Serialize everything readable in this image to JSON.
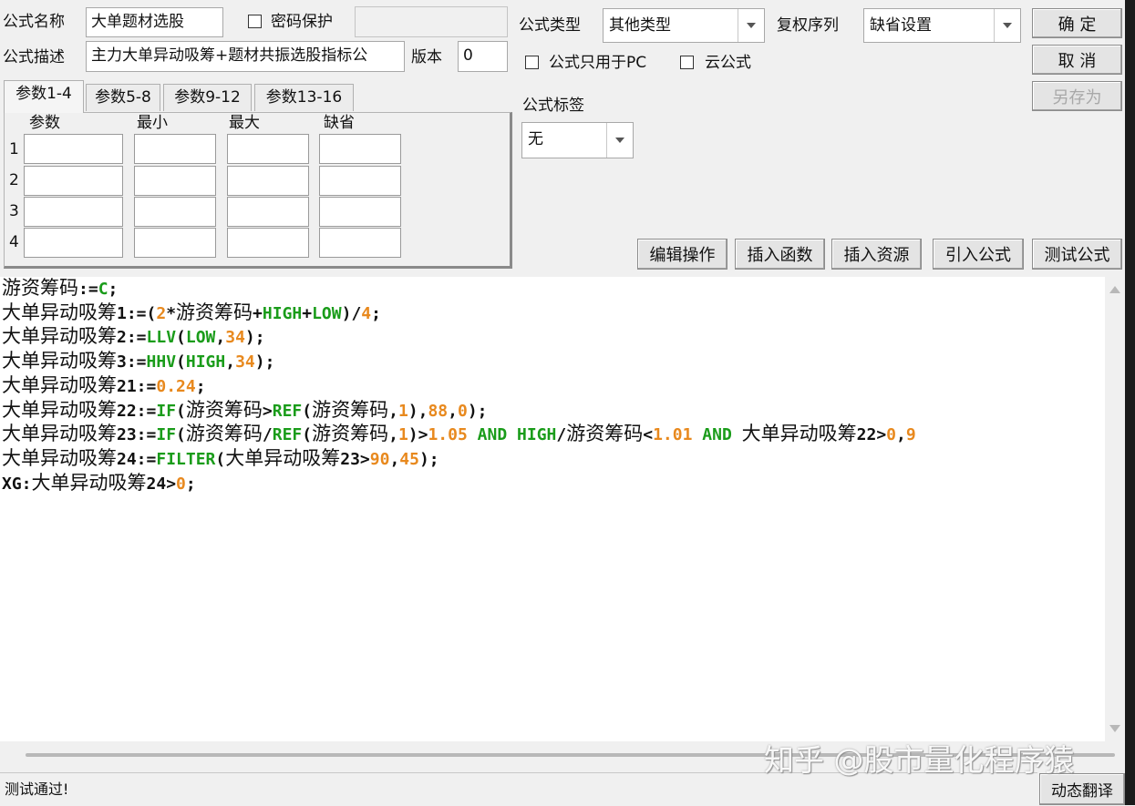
{
  "form": {
    "name_label": "公式名称",
    "name_value": "大单题材选股",
    "password_label": "密码保护",
    "desc_label": "公式描述",
    "desc_value": "主力大单异动吸筹+题材共振选股指标公",
    "version_label": "版本",
    "version_value": "0",
    "type_label": "公式类型",
    "type_value": "其他类型",
    "fq_label": "复权序列",
    "fq_value": "缺省设置",
    "pc_only_label": "公式只用于PC",
    "cloud_label": "云公式",
    "tag_label": "公式标签",
    "tag_value": "无"
  },
  "buttons": {
    "ok": "确 定",
    "cancel": "取 消",
    "save_as": "另存为",
    "edit_ops": "编辑操作",
    "insert_func": "插入函数",
    "insert_res": "插入资源",
    "import_formula": "引入公式",
    "test_formula": "测试公式",
    "dyn_translate": "动态翻译"
  },
  "tabs": [
    {
      "label": "参数1-4",
      "active": true
    },
    {
      "label": "参数5-8",
      "active": false
    },
    {
      "label": "参数9-12",
      "active": false
    },
    {
      "label": "参数13-16",
      "active": false
    }
  ],
  "param_headers": [
    "参数",
    "最小",
    "最大",
    "缺省"
  ],
  "param_rows": [
    "1",
    "2",
    "3",
    "4"
  ],
  "code_lines": [
    [
      [
        "cn",
        "游资筹码"
      ],
      [
        "op",
        ":="
      ],
      [
        "fn",
        "C"
      ],
      [
        "op",
        ";"
      ]
    ],
    [
      [
        "cn",
        "大单异动吸筹"
      ],
      [
        "op",
        "1:=("
      ],
      [
        "num",
        "2"
      ],
      [
        "op",
        "*"
      ],
      [
        "cn",
        "游资筹码"
      ],
      [
        "op",
        "+"
      ],
      [
        "fn",
        "HIGH"
      ],
      [
        "op",
        "+"
      ],
      [
        "fn",
        "LOW"
      ],
      [
        "op",
        ")/"
      ],
      [
        "num",
        "4"
      ],
      [
        "op",
        ";"
      ]
    ],
    [
      [
        "cn",
        "大单异动吸筹"
      ],
      [
        "op",
        "2:="
      ],
      [
        "fn",
        "LLV"
      ],
      [
        "op",
        "("
      ],
      [
        "fn",
        "LOW"
      ],
      [
        "op",
        ","
      ],
      [
        "num",
        "34"
      ],
      [
        "op",
        ");"
      ]
    ],
    [
      [
        "cn",
        "大单异动吸筹"
      ],
      [
        "op",
        "3:="
      ],
      [
        "fn",
        "HHV"
      ],
      [
        "op",
        "("
      ],
      [
        "fn",
        "HIGH"
      ],
      [
        "op",
        ","
      ],
      [
        "num",
        "34"
      ],
      [
        "op",
        ");"
      ]
    ],
    [
      [
        "cn",
        "大单异动吸筹"
      ],
      [
        "op",
        "21:="
      ],
      [
        "num",
        "0.24"
      ],
      [
        "op",
        ";"
      ]
    ],
    [
      [
        "cn",
        "大单异动吸筹"
      ],
      [
        "op",
        "22:="
      ],
      [
        "fn",
        "IF"
      ],
      [
        "op",
        "("
      ],
      [
        "cn",
        "游资筹码"
      ],
      [
        "op",
        ">"
      ],
      [
        "fn",
        "REF"
      ],
      [
        "op",
        "("
      ],
      [
        "cn",
        "游资筹码"
      ],
      [
        "op",
        ","
      ],
      [
        "num",
        "1"
      ],
      [
        "op",
        "),"
      ],
      [
        "num",
        "88"
      ],
      [
        "op",
        ","
      ],
      [
        "num",
        "0"
      ],
      [
        "op",
        ");"
      ]
    ],
    [
      [
        "cn",
        "大单异动吸筹"
      ],
      [
        "op",
        "23:="
      ],
      [
        "fn",
        "IF"
      ],
      [
        "op",
        "("
      ],
      [
        "cn",
        "游资筹码"
      ],
      [
        "op",
        "/"
      ],
      [
        "fn",
        "REF"
      ],
      [
        "op",
        "("
      ],
      [
        "cn",
        "游资筹码"
      ],
      [
        "op",
        ","
      ],
      [
        "num",
        "1"
      ],
      [
        "op",
        ")>"
      ],
      [
        "num",
        "1.05"
      ],
      [
        "op",
        " "
      ],
      [
        "fn",
        "AND"
      ],
      [
        "op",
        " "
      ],
      [
        "fn",
        "HIGH"
      ],
      [
        "op",
        "/"
      ],
      [
        "cn",
        "游资筹码"
      ],
      [
        "op",
        "<"
      ],
      [
        "num",
        "1.01"
      ],
      [
        "op",
        " "
      ],
      [
        "fn",
        "AND"
      ],
      [
        "op",
        " "
      ],
      [
        "cn",
        "大单异动吸筹"
      ],
      [
        "op",
        "22>"
      ],
      [
        "num",
        "0"
      ],
      [
        "op",
        ","
      ],
      [
        "num",
        "9"
      ]
    ],
    [
      [
        "cn",
        "大单异动吸筹"
      ],
      [
        "op",
        "24:="
      ],
      [
        "fn",
        "FILTER"
      ],
      [
        "op",
        "("
      ],
      [
        "cn",
        "大单异动吸筹"
      ],
      [
        "op",
        "23>"
      ],
      [
        "num",
        "90"
      ],
      [
        "op",
        ","
      ],
      [
        "num",
        "45"
      ],
      [
        "op",
        ");"
      ]
    ],
    [
      [
        "op",
        "XG:"
      ],
      [
        "cn",
        "大单异动吸筹"
      ],
      [
        "op",
        "24>"
      ],
      [
        "num",
        "0"
      ],
      [
        "op",
        ";"
      ]
    ]
  ],
  "status_text": "测试通过!",
  "watermark": "知乎 @股市量化程序猿",
  "colors": {
    "function": "#1a9c1a",
    "number": "#e8891e"
  }
}
